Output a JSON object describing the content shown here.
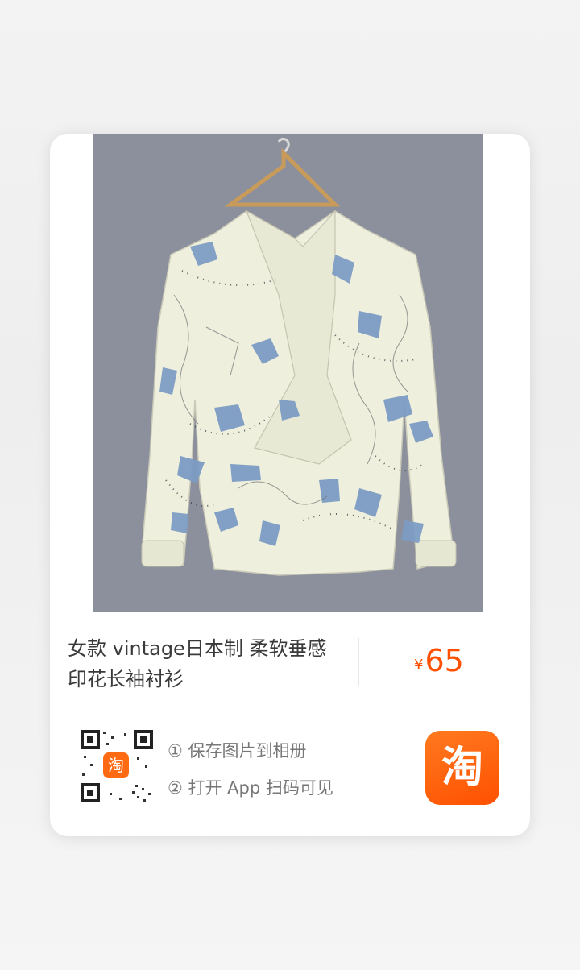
{
  "product": {
    "title": "女款 vintage日本制 柔软垂感 印花长袖衬衫",
    "currency": "¥",
    "price": "65",
    "image_alt": "printed long-sleeve blouse on hanger"
  },
  "share": {
    "step1": "① 保存图片到相册",
    "step2": "② 打开 App 扫码可见",
    "qr_logo_glyph": "淘",
    "app_logo_glyph": "淘"
  },
  "colors": {
    "price": "#ff5000",
    "logo": "#ff5000",
    "image_background": "#8c8f9c",
    "blouse_fabric": "#eeefdd",
    "blouse_print": "#7d9cc4"
  }
}
